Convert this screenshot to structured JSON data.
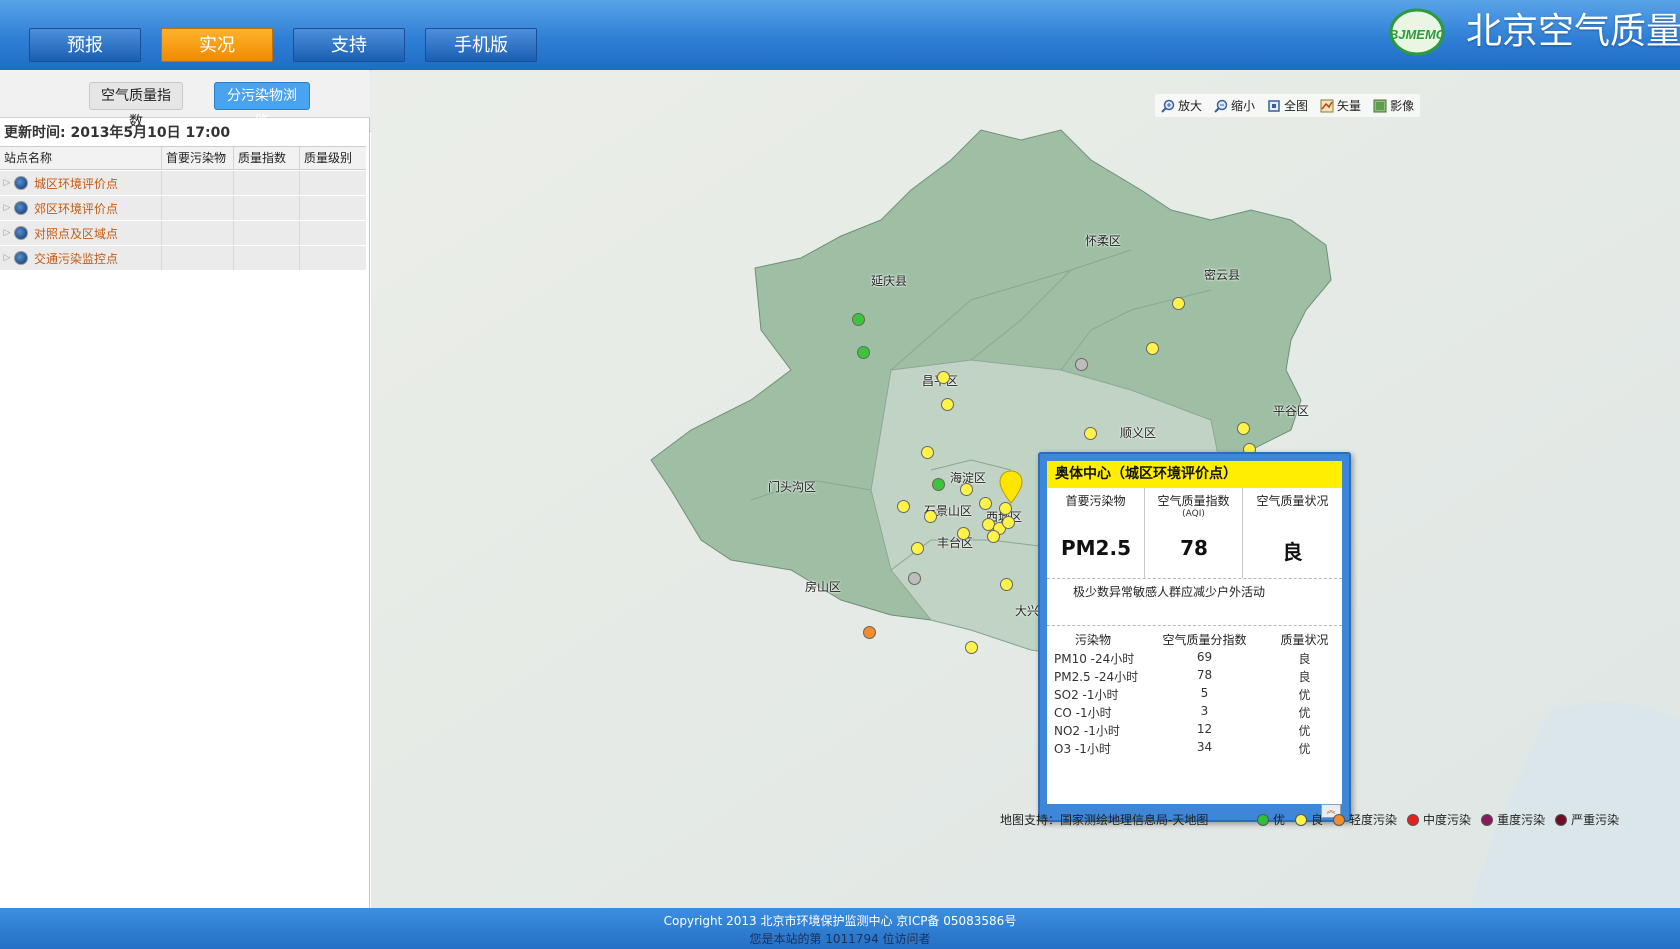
{
  "header": {
    "nav": [
      {
        "label": "预报",
        "active": false
      },
      {
        "label": "实况",
        "active": true
      },
      {
        "label": "支持",
        "active": false
      },
      {
        "label": "手机版",
        "active": false
      }
    ],
    "logo_text": "BJMEMC",
    "site_title": "北京空气质量"
  },
  "sidebar": {
    "tabs": [
      {
        "label": "空气质量指数",
        "active": false
      },
      {
        "label": "分污染物浏览",
        "active": true
      }
    ],
    "update_time": "更新时间: 2013年5月10日 17:00",
    "columns": [
      "站点名称",
      "首要污染物",
      "质量指数",
      "质量级别"
    ],
    "groups": [
      {
        "label": "城区环境评价点"
      },
      {
        "label": "郊区环境评价点"
      },
      {
        "label": "对照点及区域点"
      },
      {
        "label": "交通污染监控点"
      }
    ]
  },
  "map": {
    "toolbar": [
      {
        "label": "放大",
        "icon": "zoom-in-icon"
      },
      {
        "label": "缩小",
        "icon": "zoom-out-icon"
      },
      {
        "label": "全图",
        "icon": "full-extent-icon"
      },
      {
        "label": "矢量",
        "icon": "vector-map-icon"
      },
      {
        "label": "影像",
        "icon": "imagery-icon"
      }
    ],
    "places": [
      "延庆县",
      "怀柔区",
      "密云县",
      "昌平区",
      "顺义区",
      "平谷区",
      "门头沟区",
      "海淀区",
      "石景山区",
      "西城区",
      "丰台区",
      "房山区",
      "大兴区"
    ],
    "credit": "地图支持：国家测绘地理信息局-天地图",
    "legend": [
      {
        "label": "优",
        "color": "#2fbf3a"
      },
      {
        "label": "良",
        "color": "#fff34a"
      },
      {
        "label": "轻度污染",
        "color": "#f28d2b"
      },
      {
        "label": "中度污染",
        "color": "#e8201c"
      },
      {
        "label": "重度污染",
        "color": "#8a1a5e"
      },
      {
        "label": "严重污染",
        "color": "#6e0d26"
      }
    ]
  },
  "popup": {
    "title": "奥体中心（城区环境评价点）",
    "primary_pollutant_label": "首要污染物",
    "primary_pollutant": "PM2.5",
    "aqi_label": "空气质量指数",
    "aqi_sub": "(AQI)",
    "aqi": "78",
    "status_label": "空气质量状况",
    "status": "良",
    "advice": "极少数异常敏感人群应减少户外活动",
    "columns": [
      "污染物",
      "空气质量分指数",
      "质量状况"
    ],
    "rows": [
      {
        "pollutant": "PM10 -24小时",
        "index": "69",
        "status": "良"
      },
      {
        "pollutant": "PM2.5 -24小时",
        "index": "78",
        "status": "良"
      },
      {
        "pollutant": "SO2 -1小时",
        "index": "5",
        "status": "优"
      },
      {
        "pollutant": "CO -1小时",
        "index": "3",
        "status": "优"
      },
      {
        "pollutant": "NO2 -1小时",
        "index": "12",
        "status": "优"
      },
      {
        "pollutant": "O3 -1小时",
        "index": "34",
        "status": "优"
      }
    ]
  },
  "footer": {
    "copyright": "Copyright 2013 北京市环境保护监测中心 京ICP备 05083586号",
    "visitors": "您是本站的第 1011794 位访问者"
  }
}
